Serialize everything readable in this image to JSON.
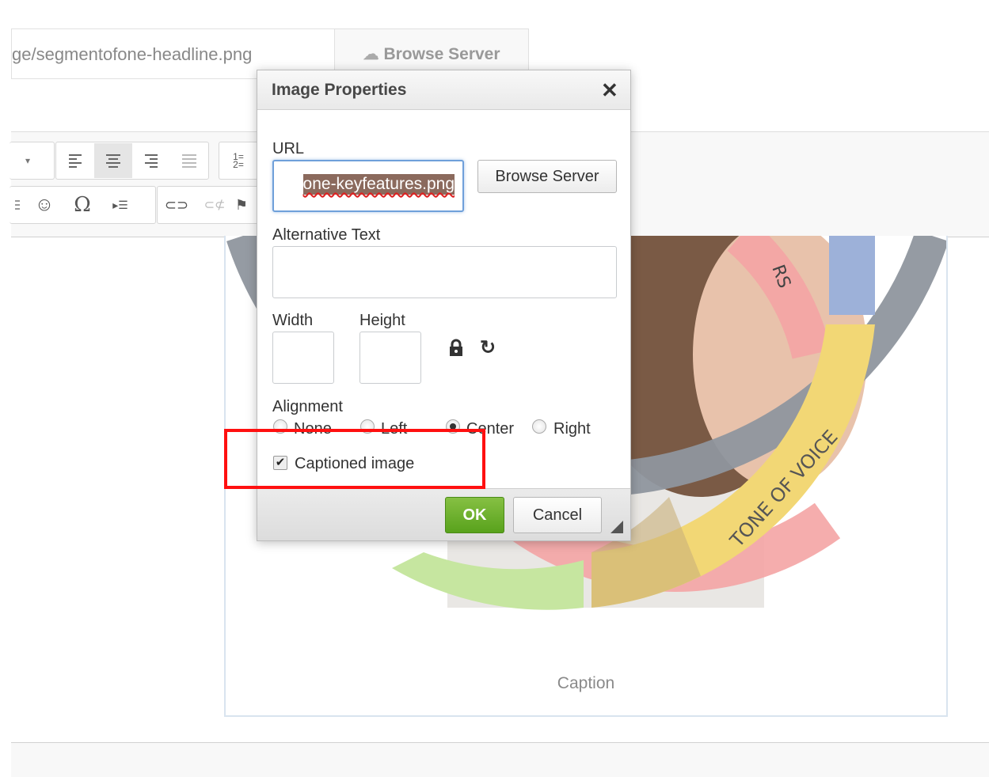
{
  "background": {
    "url_value": "ge/segmentofone-headline.png",
    "browse_server_label": "Browse Server",
    "caption": "Caption",
    "diagram_labels": [
      "RS",
      "TONE OF VOICE"
    ]
  },
  "dialog": {
    "title": "Image Properties",
    "url_label": "URL",
    "url_value": "one-keyfeatures.png",
    "browse_server_label": "Browse Server",
    "alt_label": "Alternative Text",
    "alt_value": "",
    "width_label": "Width",
    "width_value": "",
    "height_label": "Height",
    "height_value": "",
    "alignment_label": "Alignment",
    "alignment_options": [
      "None",
      "Left",
      "Center",
      "Right"
    ],
    "alignment_selected": "Center",
    "captioned_label": "Captioned image",
    "captioned_checked": true,
    "ok_label": "OK",
    "cancel_label": "Cancel"
  },
  "colors": {
    "highlight": "#ff1010",
    "ok_green": "#6ab42e",
    "url_selection": "#8b6a5d"
  }
}
